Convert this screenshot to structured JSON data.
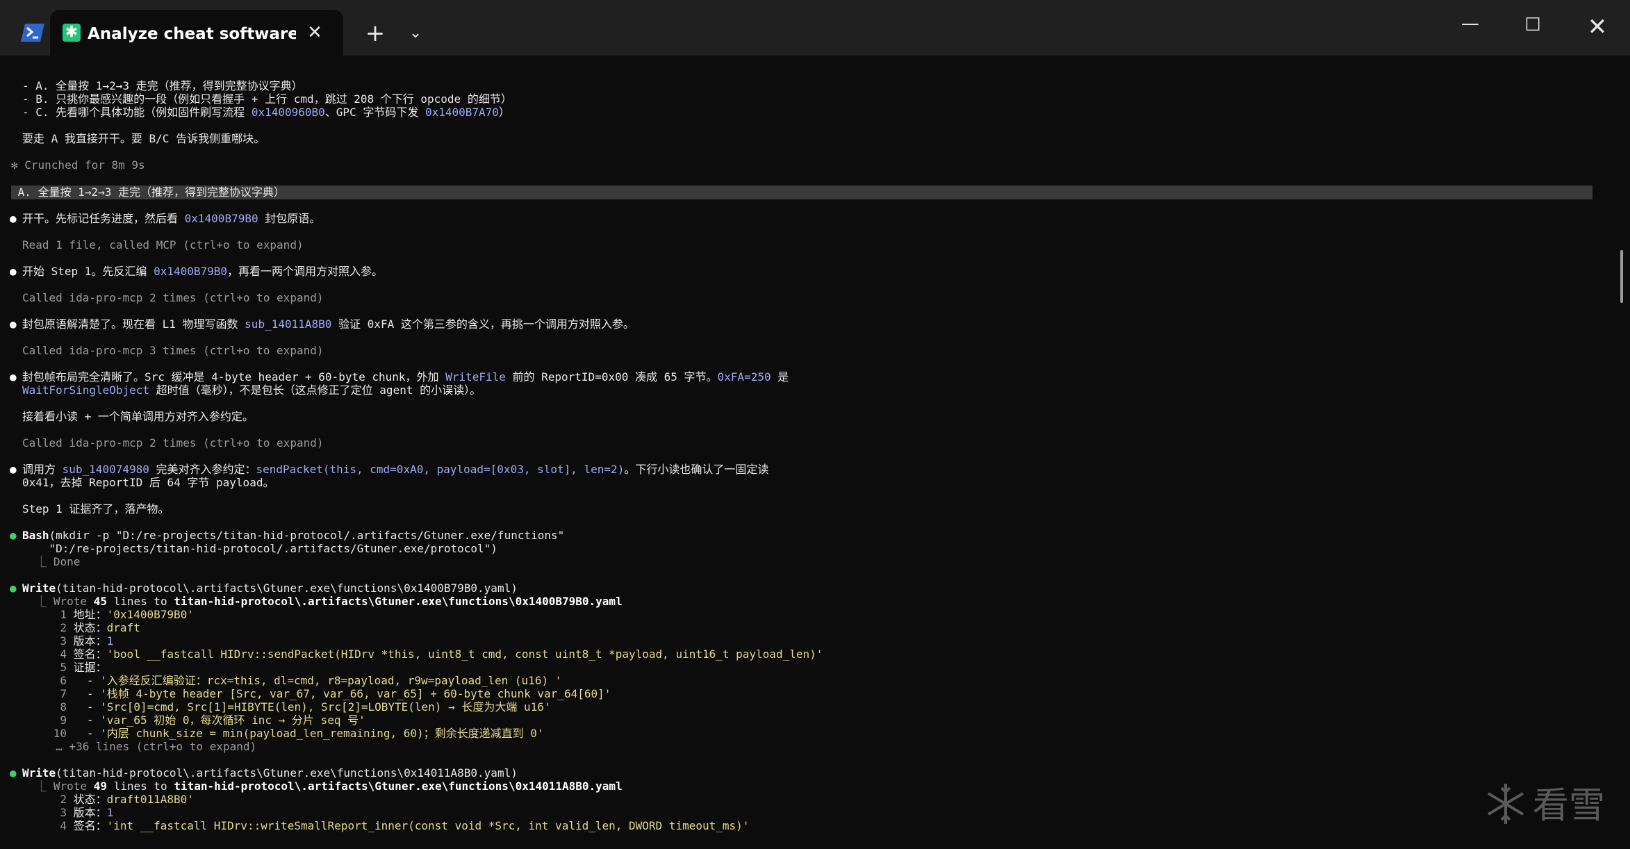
{
  "tab": {
    "title": "Analyze cheat software har",
    "close_glyph": "✕",
    "new_tab_glyph": "+",
    "dropdown_glyph": "⌄",
    "app_icon_glyph": "✱"
  },
  "window": {
    "minimize_glyph": "—",
    "maximize_glyph": "☐",
    "close_glyph": "✕"
  },
  "terminal": {
    "options": [
      "- A. 全量按 1→2→3 走完（推荐，得到完整协议字典）",
      "- B. 只挑你最感兴趣的一段（例如只看握手 + 上行 cmd，跳过 208 个下行 opcode 的细节）",
      "- C. 先看哪个具体功能（例如固件刷写流程 ",
      "0x1400960B0",
      "、GPC 字节码下发 ",
      "0x1400B7A70",
      "）"
    ],
    "prompt_line": "要走 A 我直接开干。要 B/C 告诉我侧重哪块。",
    "crunched": "✻ Crunched for 8m 9s",
    "selected": " A. 全量按 1→2→3 走完（推荐，得到完整协议字典）",
    "l1_a": "开干。先标记任务进度，然后看 ",
    "l1_b": "0x1400B79B0",
    "l1_c": " 封包原语。",
    "read1": "Read 1 file, called MCP (ctrl+o to expand)",
    "l2_a": "开始 Step 1。先反汇编 ",
    "l2_b": "0x1400B79B0",
    "l2_c": "，再看一两个调用方对照入参。",
    "called2": "Called ida-pro-mcp 2 times (ctrl+o to expand)",
    "l3_a": "封包原语解清楚了。现在看 L1 物理写函数 ",
    "l3_b": "sub_14011A8B0",
    "l3_c": " 验证 0xFA 这个第三参的含义，再挑一个调用方对照入参。",
    "called3": "Called ida-pro-mcp 3 times (ctrl+o to expand)",
    "l4_a": "封包帧布局完全清晰了。Src 缓冲是 4-byte header + 60-byte chunk，外加 ",
    "l4_b": "WriteFile",
    "l4_c": " 前的 ReportID=0x00 凑成 65 字节。",
    "l4_d": "0xFA=250",
    "l4_e": " 是",
    "l4b_a": "WaitForSingleObject",
    "l4b_b": " 超时值（毫秒），不是包长（这点修正了定位 agent 的小误读）。",
    "l5": "接着看小读 + 一个简单调用方对齐入参约定。",
    "called4": "Called ida-pro-mcp 2 times (ctrl+o to expand)",
    "l6_a": "调用方 ",
    "l6_b": "sub_140074980",
    "l6_c": " 完美对齐入参约定：",
    "l6_d": "sendPacket(this, cmd=0xA0, payload=[0x03, slot], len=2)",
    "l6_e": "。下行小读也确认了一固定读",
    "l6b": "0x41，去掉 ReportID 后 64 字节 payload。",
    "l7": "Step 1 证据齐了，落产物。",
    "bash_a": "Bash",
    "bash_b": "(mkdir -p \"D:/re-projects/titan-hid-protocol/.artifacts/Gtuner.exe/functions\"",
    "bash2": "    \"D:/re-projects/titan-hid-protocol/.artifacts/Gtuner.exe/protocol\")",
    "bash_done": "  ⎿ Done",
    "w1_a": "Write",
    "w1_b": "(titan-hid-protocol\\.artifacts\\Gtuner.exe\\functions\\0x1400B79B0.yaml)",
    "w1_res_a": "  ⎿ Wrote ",
    "w1_res_b": "45",
    "w1_res_c": " lines to ",
    "w1_res_d": "titan-hid-protocol\\.artifacts\\Gtuner.exe\\functions\\0x1400B79B0.yaml",
    "y1": [
      {
        "n": "1",
        "k": "地址：",
        "v": "'0x1400B79B0'"
      },
      {
        "n": "2",
        "k": "状态：",
        "v": "draft"
      },
      {
        "n": "3",
        "k": "版本：",
        "v": "1"
      },
      {
        "n": "4",
        "k": "签名：",
        "v": "'bool __fastcall HIDrv::sendPacket(HIDrv *this, uint8_t cmd, const uint8_t *payload, uint16_t payload_len)'"
      },
      {
        "n": "5",
        "k": "证据：",
        "v": ""
      },
      {
        "n": "6",
        "k": "  - ",
        "v": "'入参经反汇编验证：rcx=this, dl=cmd, r8=payload, r9w=payload_len (u16) '"
      },
      {
        "n": "7",
        "k": "  - ",
        "v": "'栈帧 4-byte header [Src, var_67, var_66, var_65] + 60-byte chunk var_64[60]'"
      },
      {
        "n": "8",
        "k": "  - ",
        "v": "'Src[0]=cmd, Src[1]=HIBYTE(len), Src[2]=LOBYTE(len) → 长度为大端 u16'"
      },
      {
        "n": "9",
        "k": "  - ",
        "v": "'var_65 初始 0，每次循环 inc → 分片 seq 号'"
      },
      {
        "n": "10",
        "k": "  - ",
        "v": "'内层 chunk_size = min(payload_len_remaining, 60)；剩余长度递减直到 0'"
      }
    ],
    "w1_more": "     … +36 lines (ctrl+o to expand)",
    "w2_a": "Write",
    "w2_b": "(titan-hid-protocol\\.artifacts\\Gtuner.exe\\functions\\0x14011A8B0.yaml)",
    "w2_res_a": "  ⎿ Wrote ",
    "w2_res_b": "49",
    "w2_res_c": " lines to ",
    "w2_res_d": "titan-hid-protocol\\.artifacts\\Gtuner.exe\\functions\\0x14011A8B0.yaml",
    "y2": [
      {
        "n": "2",
        "k": "状态：",
        "v": "draft011A8B0'"
      },
      {
        "n": "3",
        "k": "版本：",
        "v": "1"
      },
      {
        "n": "4",
        "k": "签名：",
        "v": "'int __fastcall HIDrv::writeSmallReport_inner(const void *Src, int valid_len, DWORD timeout_ms)'"
      }
    ]
  },
  "watermark": {
    "text": "看雪"
  },
  "colors": {
    "background": "#0c0c0c",
    "titlebar": "#202020",
    "highlight": "#9fa8f5",
    "green": "#3fcf6a"
  }
}
